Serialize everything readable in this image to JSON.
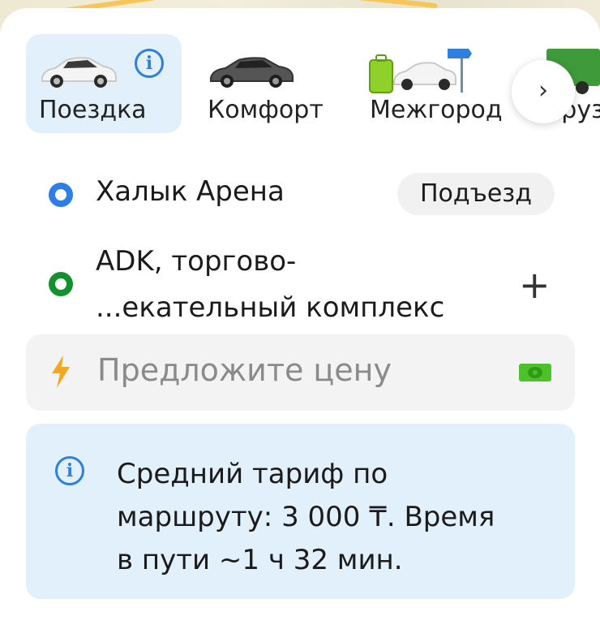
{
  "tariffs": [
    {
      "label": "Поездка",
      "selected": true
    },
    {
      "label": "Комфорт",
      "selected": false
    },
    {
      "label": "Межгород",
      "selected": false
    },
    {
      "label": "Грузовой",
      "selected": false
    }
  ],
  "tariff_info_icon": "info-icon",
  "tariff_next_icon": "chevron-right-icon",
  "route": {
    "pickup": "Халык Арена",
    "pickup_chip": "Подъезд",
    "destination_line1": "ADK, торгово-",
    "destination_line2": "...екательный комплекс",
    "add_stop_icon": "plus-icon"
  },
  "price": {
    "placeholder": "Предложите цену",
    "icon": "lightning-icon",
    "payment_icon": "cash-icon"
  },
  "info": {
    "line1": "Средний тариф по",
    "line2": "маршруту: 3 000 ₸. Время",
    "line3": "в пути ~1 ч 32 мин.",
    "icon": "info-icon"
  },
  "colors": {
    "accent_blue": "#2e7fe0",
    "pickup_dot": "#2f7de6",
    "destination_dot": "#12922f",
    "selected_bg": "#e1f0fb",
    "cash_green": "#4ec02a"
  }
}
